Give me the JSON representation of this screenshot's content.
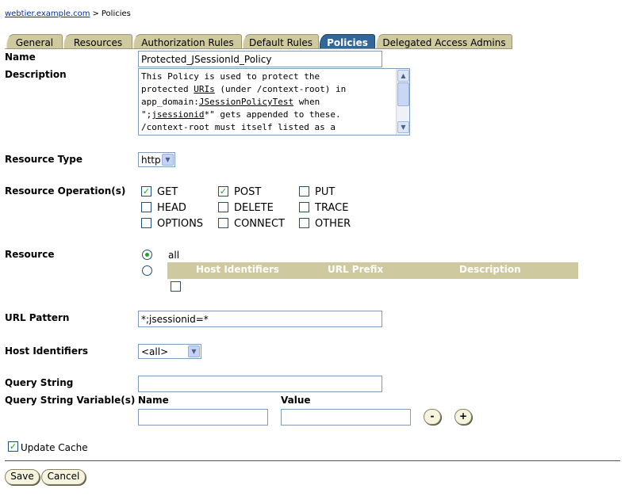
{
  "breadcrumb": {
    "root_link": "webtier.example.com",
    "separator": ">",
    "current": "Policies"
  },
  "tabs": [
    {
      "label": "General",
      "active": false
    },
    {
      "label": "Resources",
      "active": false
    },
    {
      "label": "Authorization Rules",
      "active": false
    },
    {
      "label": "Default Rules",
      "active": false
    },
    {
      "label": "Policies",
      "active": true
    },
    {
      "label": "Delegated Access Admins",
      "active": false
    }
  ],
  "form": {
    "name_label": "Name",
    "name_value": "Protected_JSessionId_Policy",
    "description_label": "Description",
    "description_lines": [
      "This Policy is used to protect the",
      "protected URIs (under /context-root) in",
      "app_domain:JSessionPolicyTest when",
      "\";jsessionid*\" gets appended to these.",
      "/context-root must itself listed as a"
    ],
    "resource_type_label": "Resource Type",
    "resource_type_value": "http",
    "resource_operations_label": "Resource Operation(s)",
    "operations": [
      {
        "label": "GET",
        "checked": true
      },
      {
        "label": "POST",
        "checked": true
      },
      {
        "label": "PUT",
        "checked": false
      },
      {
        "label": "HEAD",
        "checked": false
      },
      {
        "label": "DELETE",
        "checked": false
      },
      {
        "label": "TRACE",
        "checked": false
      },
      {
        "label": "OPTIONS",
        "checked": false
      },
      {
        "label": "CONNECT",
        "checked": false
      },
      {
        "label": "OTHER",
        "checked": false
      }
    ],
    "resource_label": "Resource",
    "resource_all_label": "all",
    "resource_table_headers": [
      "Host Identifiers",
      "URL Prefix",
      "Description"
    ],
    "url_pattern_label": "URL Pattern",
    "url_pattern_value": "*;jsessionid=*",
    "host_identifiers_label": "Host Identifiers",
    "host_identifiers_value": "<all>",
    "query_string_label": "Query String",
    "query_string_value": "",
    "query_vars_label": "Query String Variable(s)",
    "query_name_header": "Name",
    "query_value_header": "Value",
    "minus_label": "-",
    "plus_label": "+",
    "update_cache_label": "Update Cache",
    "update_cache_checked": true
  },
  "buttons": {
    "save": "Save",
    "cancel": "Cancel"
  },
  "colors": {
    "tab": "#cfc99f",
    "tab_active": "#336699",
    "link": "#003399",
    "check": "#21a121"
  }
}
